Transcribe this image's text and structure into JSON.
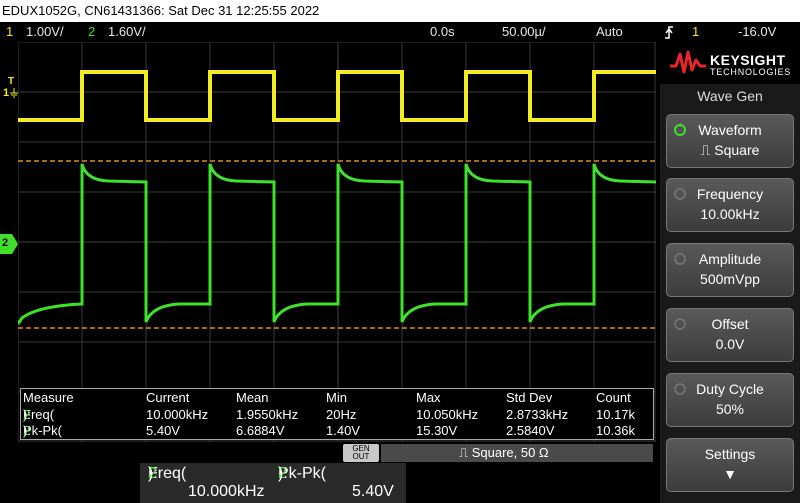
{
  "titlebar": {
    "text": "EDUX1052G, CN61431366: Sat Dec 31 12:25:55 2022"
  },
  "status": {
    "ch1_num": "1",
    "ch1_scale": "1.00V/",
    "ch2_num": "2",
    "ch2_scale": "1.60V/",
    "time_pos": "0.0s",
    "time_scale": "50.00µ/",
    "trigger_mode": "Auto",
    "trigger_icon": "trigger-edge-icon",
    "trigger_src": "1",
    "trigger_level": "-16.0V"
  },
  "markers": {
    "ch1": "1",
    "ch1_t": "T",
    "ch2": "2"
  },
  "colors": {
    "ch1": "#f2ea22",
    "ch2": "#3ee02a",
    "trigger": "#f08a1c",
    "cursor_dash": "#e08a2a"
  },
  "logo": {
    "brand": "KEYSIGHT",
    "sub": "TECHNOLOGIES"
  },
  "panel": {
    "title": "Wave Gen",
    "keys": [
      {
        "l1": "Waveform",
        "l2": "⎍ Square"
      },
      {
        "l1": "Frequency",
        "l2": "10.00kHz"
      },
      {
        "l1": "Amplitude",
        "l2": "500mVpp"
      },
      {
        "l1": "Offset",
        "l2": "0.0V"
      },
      {
        "l1": "Duty Cycle",
        "l2": "50%"
      },
      {
        "l1": "Settings",
        "l2": "▼"
      }
    ]
  },
  "measure": {
    "headers": [
      "Measure",
      "Current",
      "Mean",
      "Min",
      "Max",
      "Std Dev",
      "Count"
    ],
    "rows": [
      {
        "name": "Freq(",
        "ch": "2",
        "close": "):",
        "vals": [
          "10.000kHz",
          "1.9550kHz",
          "20Hz",
          "10.050kHz",
          "2.8733kHz",
          "10.17k"
        ]
      },
      {
        "name": "Pk-Pk(",
        "ch": "2",
        "close": "):",
        "vals": [
          "5.40V",
          "6.6884V",
          "1.40V",
          "15.30V",
          "2.5840V",
          "10.36k"
        ]
      }
    ]
  },
  "gen": {
    "label_top": "GEN",
    "label_bot": "OUT",
    "desc": "⎍ Square, 50 Ω"
  },
  "lower": {
    "m1_name": "Freq(",
    "m1_ch": "2",
    "m1_close": "):",
    "m1_val": "10.000kHz",
    "m2_name": "Pk-Pk(",
    "m2_ch": "2",
    "m2_close": "):",
    "m2_val": "5.40V"
  }
}
